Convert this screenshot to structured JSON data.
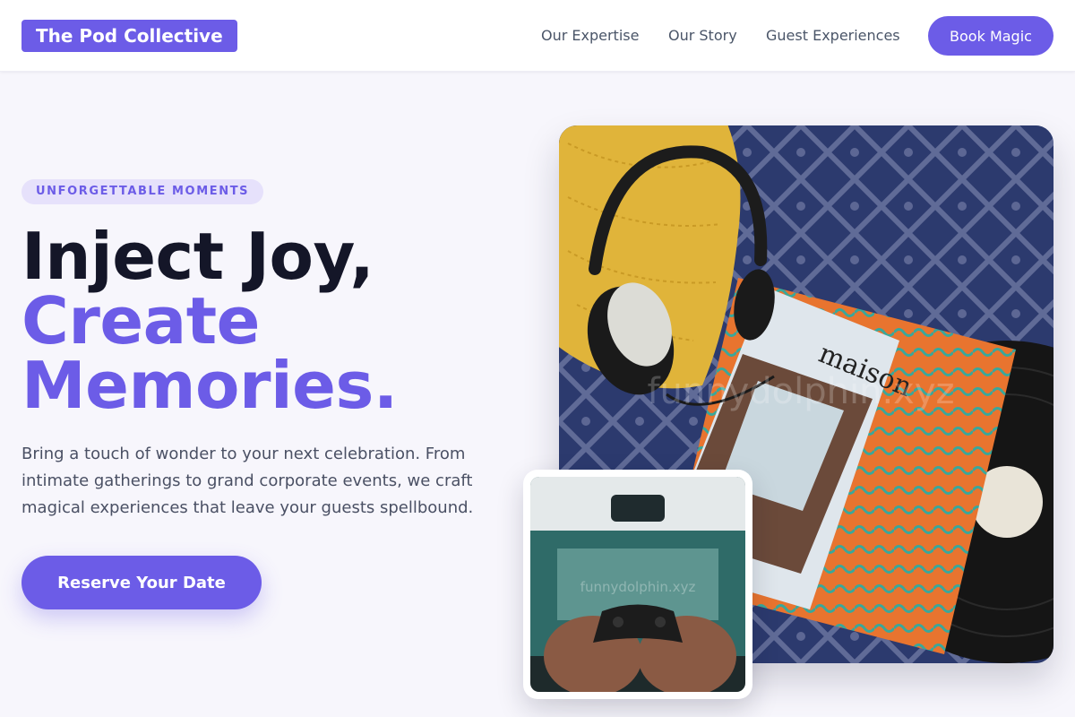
{
  "header": {
    "logo": "The Pod Collective",
    "nav": [
      "Our Expertise",
      "Our Story",
      "Guest Experiences"
    ],
    "cta": "Book Magic"
  },
  "hero": {
    "eyebrow": "UNFORGETTABLE MOMENTS",
    "headline_line1": "Inject Joy,",
    "headline_line2": "Create",
    "headline_line3": "Memories.",
    "lead": "Bring a touch of wonder to your next celebration. From intimate gatherings to grand corporate events, we craft magical experiences that leave your guests spellbound.",
    "button": "Reserve Your Date"
  },
  "images": {
    "main": {
      "icon": "headphones-vinyl-magazine-photo",
      "magazine_title": "maison",
      "watermark": "funnydolphin.xyz"
    },
    "thumb": {
      "icon": "game-controller-photo",
      "watermark": "funnydolphin.xyz"
    }
  },
  "colors": {
    "accent": "#6c5ce7",
    "dark": "#141628",
    "background": "#f7f6fc"
  }
}
